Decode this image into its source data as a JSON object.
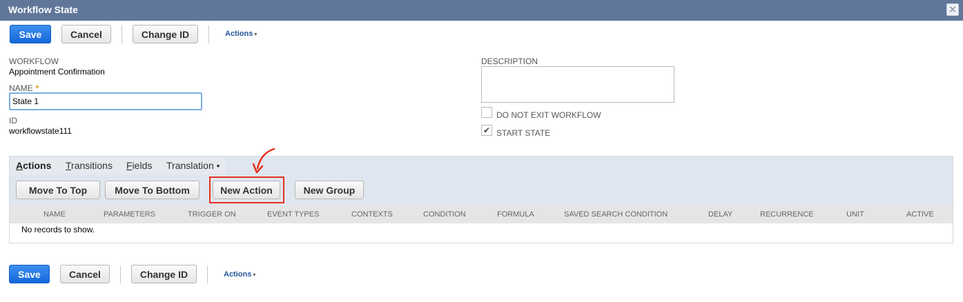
{
  "window": {
    "title": "Workflow State",
    "close_glyph": "✕"
  },
  "toolbar": {
    "save_label": "Save",
    "cancel_label": "Cancel",
    "change_id_label": "Change ID",
    "actions_label": "Actions",
    "actions_caret": "▾"
  },
  "form": {
    "workflow_label": "WORKFLOW",
    "workflow_value": "Appointment Confirmation",
    "name_label": "NAME",
    "required_mark": "*",
    "name_value": "State 1",
    "id_label": "ID",
    "id_value": "workflowstate111",
    "description_label": "DESCRIPTION",
    "description_value": "",
    "do_not_exit_label": "DO NOT EXIT WORKFLOW",
    "do_not_exit_checked": false,
    "start_state_label": "START STATE",
    "start_state_checked": true,
    "check_glyph": "✔"
  },
  "tabs": [
    {
      "label": "Actions",
      "underline": "A",
      "rest": "ctions",
      "active": true
    },
    {
      "label": "Transitions",
      "underline": "T",
      "rest": "ransitions",
      "active": false
    },
    {
      "label": "Fields",
      "underline": "F",
      "rest": "ields",
      "active": false
    },
    {
      "label": "Translation •",
      "underline": "",
      "rest": "Translation •",
      "active": false
    }
  ],
  "subtab_buttons": {
    "move_to_top": "Move To Top",
    "move_to_bottom": "Move To Bottom",
    "new_action": "New Action",
    "new_group": "New Group"
  },
  "table": {
    "columns": [
      "NAME",
      "PARAMETERS",
      "TRIGGER ON",
      "EVENT TYPES",
      "CONTEXTS",
      "CONDITION",
      "FORMULA",
      "SAVED SEARCH CONDITION",
      "DELAY",
      "RECURRENCE",
      "UNIT",
      "ACTIVE"
    ],
    "empty_message": "No records to show."
  },
  "colors": {
    "titlebar": "#607799",
    "primary_button": "#1f76e6",
    "annotation": "#e62e1f"
  }
}
